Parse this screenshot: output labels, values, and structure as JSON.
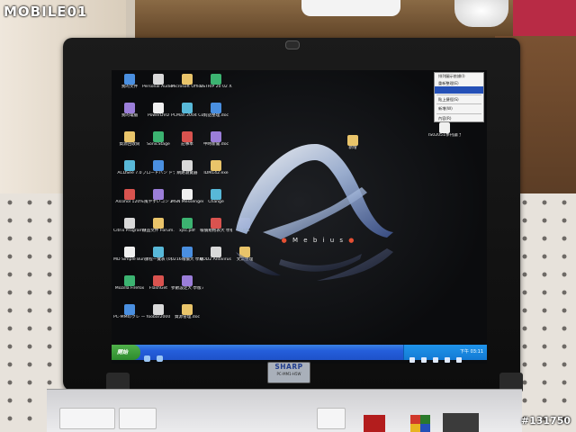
{
  "watermark": {
    "brand": "MOBILE01"
  },
  "photo_id": "#131750",
  "brand_plate": {
    "name": "SHARP",
    "model": "PC-MM1-H5W"
  },
  "wallpaper": {
    "letters": [
      "M",
      "e",
      "b",
      "i",
      "u",
      "s"
    ]
  },
  "context_menu": {
    "items": [
      {
        "label": "排列圖示依據(I)"
      },
      {
        "label": "重新整理(E)"
      },
      {
        "label": ""
      },
      {
        "label": "貼上捷徑(S)"
      },
      {
        "label": "新增(W)"
      },
      {
        "label": "內容(R)"
      }
    ]
  },
  "desktop_icons": [
    {
      "label": "我的文件"
    },
    {
      "label": "Personal Audio 使用說明"
    },
    {
      "label": "Microsoft Office Wo..."
    },
    {
      "label": "CSTRIP 20 02 XXX"
    },
    {
      "label": ""
    },
    {
      "label": "我的電腦"
    },
    {
      "label": "PowerDVD"
    },
    {
      "label": "PCMan 2004 Combo"
    },
    {
      "label": "對話整理.doc"
    },
    {
      "label": ""
    },
    {
      "label": "資源回收筒"
    },
    {
      "label": "SonicStage"
    },
    {
      "label": "記事本"
    },
    {
      "label": "中時新聞.doc"
    },
    {
      "label": ""
    },
    {
      "label": "ACDSee 7.0"
    },
    {
      "label": "プロードバン ドナビゲ..."
    },
    {
      "label": "網路瀏覽器"
    },
    {
      "label": "IDM142.exe"
    },
    {
      "label": ""
    },
    {
      "label": "Alcohol 120%"
    },
    {
      "label": "風やすいコン 2"
    },
    {
      "label": "MSN Messenger 7.5"
    },
    {
      "label": "Change"
    },
    {
      "label": ""
    },
    {
      "label": "Citrix Program Neighborhood"
    },
    {
      "label": "競品文件 Forum..."
    },
    {
      "label": "xjsc.pdf"
    },
    {
      "label": "報價規格表大 學版.doc"
    },
    {
      "label": "MISE"
    },
    {
      "label": "MD Simple Burner"
    },
    {
      "label": "課程一覽表 (0)"
    },
    {
      "label": "0216報價大 學版.doc"
    },
    {
      "label": "BOD2 Antivirus Sys..."
    },
    {
      "label": "文案整理"
    },
    {
      "label": "Mozilla Firefox"
    },
    {
      "label": "FlashGet"
    },
    {
      "label": "參數設定大 學版.doc"
    },
    {
      "label": ""
    },
    {
      "label": ""
    },
    {
      "label": "PC-MMのクレ ードル活用"
    },
    {
      "label": "foobar2000"
    },
    {
      "label": "資源管理.doc"
    },
    {
      "label": ""
    },
    {
      "label": ""
    }
  ],
  "right_icons": [
    {
      "label": "IS02051季刊論 文標題.doc"
    },
    {
      "label": "新增"
    }
  ],
  "taskbar": {
    "start_label": "開始",
    "clock": "下午 03:11"
  },
  "colors": {
    "taskbar": "#245edb",
    "start_button": "#3a9a38",
    "menu_highlight": "#2450b7",
    "mebius_dot": "#e65033"
  }
}
